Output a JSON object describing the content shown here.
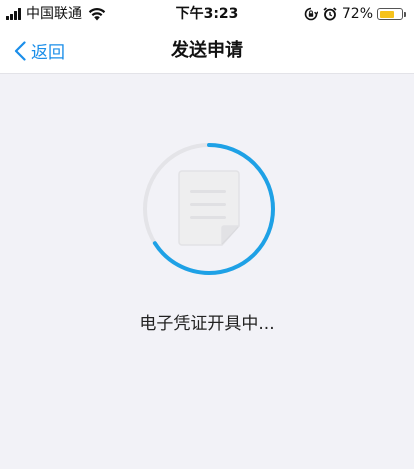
{
  "status_bar": {
    "carrier": "中国联通",
    "time": "下午3:23",
    "battery_percent": "72%",
    "battery_level": 0.72,
    "icons": [
      "signal-icon",
      "wifi-icon",
      "lock-rotation-icon",
      "alarm-icon",
      "battery-icon"
    ]
  },
  "nav": {
    "back_label": "返回",
    "title": "发送申请",
    "accent_color": "#1a8ee9"
  },
  "main": {
    "status_text": "电子凭证开具中...",
    "progress": 0.66,
    "ring_color": "#1ea1e6",
    "track_color": "#e4e4e8",
    "icon": "document-icon"
  }
}
